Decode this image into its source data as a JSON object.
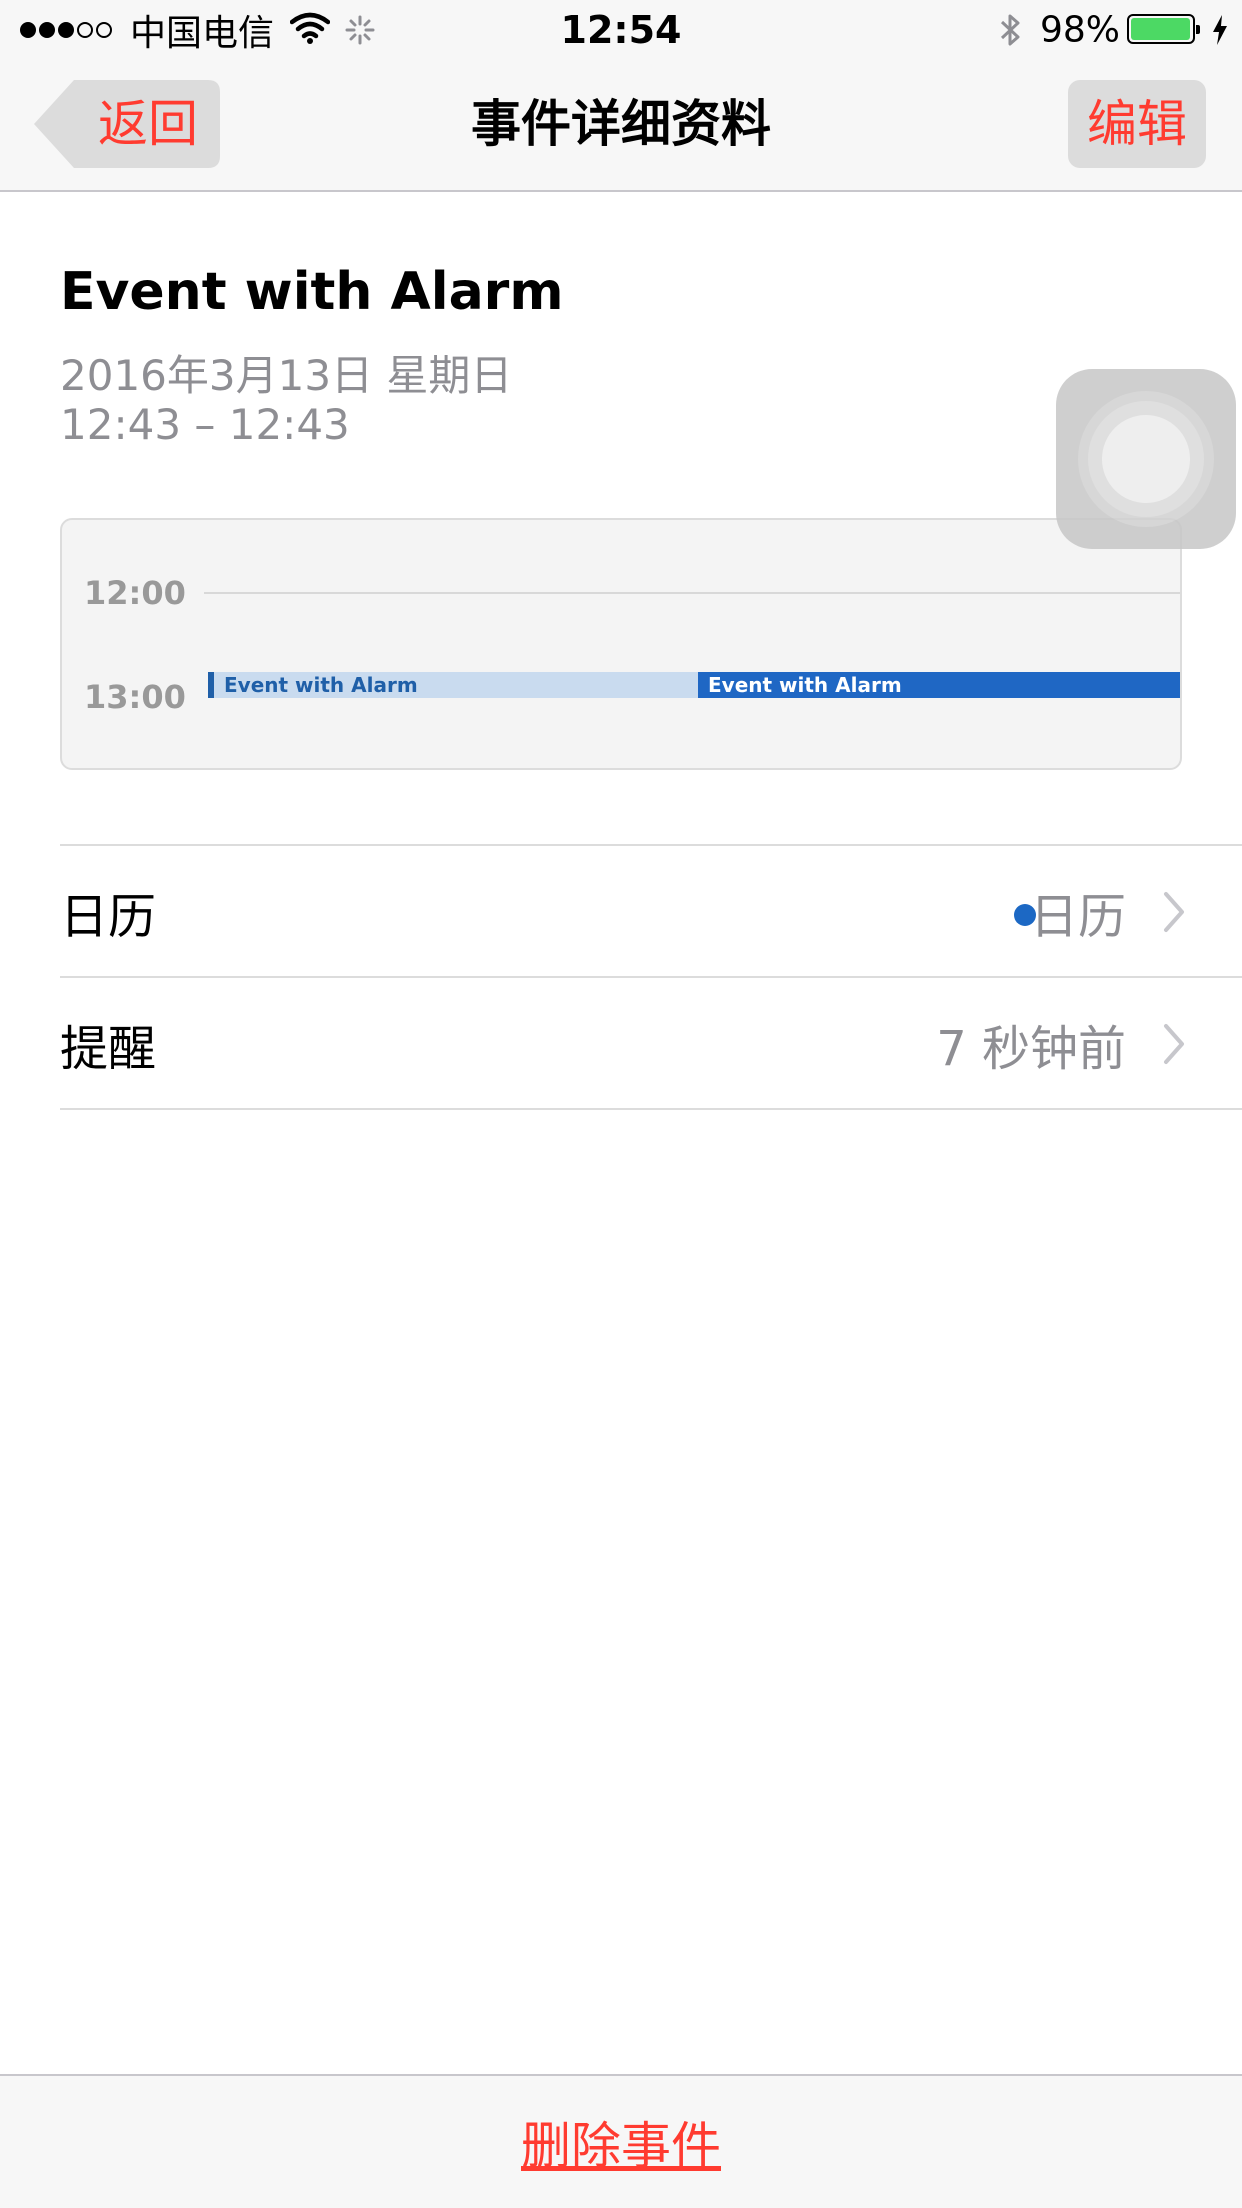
{
  "status_bar": {
    "signal_dots": [
      true,
      true,
      true,
      false,
      false
    ],
    "carrier": "中国电信",
    "time": "12:54",
    "battery_percent": "98%",
    "battery_level": 0.98,
    "battery_color": "#4cd964"
  },
  "nav": {
    "back_label": "返回",
    "title": "事件详细资料",
    "edit_label": "编辑"
  },
  "event": {
    "title": "Event with Alarm",
    "date": "2016年3月13日 星期日",
    "time": "12:43 – 12:43"
  },
  "day_preview": {
    "hours": [
      "12:00",
      "13:00"
    ],
    "events": [
      {
        "label": "Event with Alarm",
        "style": "light"
      },
      {
        "label": "Event with Alarm",
        "style": "dark"
      }
    ]
  },
  "rows": [
    {
      "label": "日历",
      "value": "日历",
      "dot_color": "#1c68c4"
    },
    {
      "label": "提醒",
      "value": "7 秒钟前"
    }
  ],
  "footer": {
    "delete_label": "删除事件"
  },
  "colors": {
    "accent": "#ff3b30",
    "event_blue": "#1f67c4",
    "secondary_text": "#8e8e93"
  },
  "icons": [
    "signal-dots-icon",
    "wifi-icon",
    "activity-spinner-icon",
    "bluetooth-icon",
    "battery-icon",
    "charging-bolt-icon",
    "back-arrow-icon",
    "chevron-right-icon",
    "assistive-touch-icon"
  ]
}
